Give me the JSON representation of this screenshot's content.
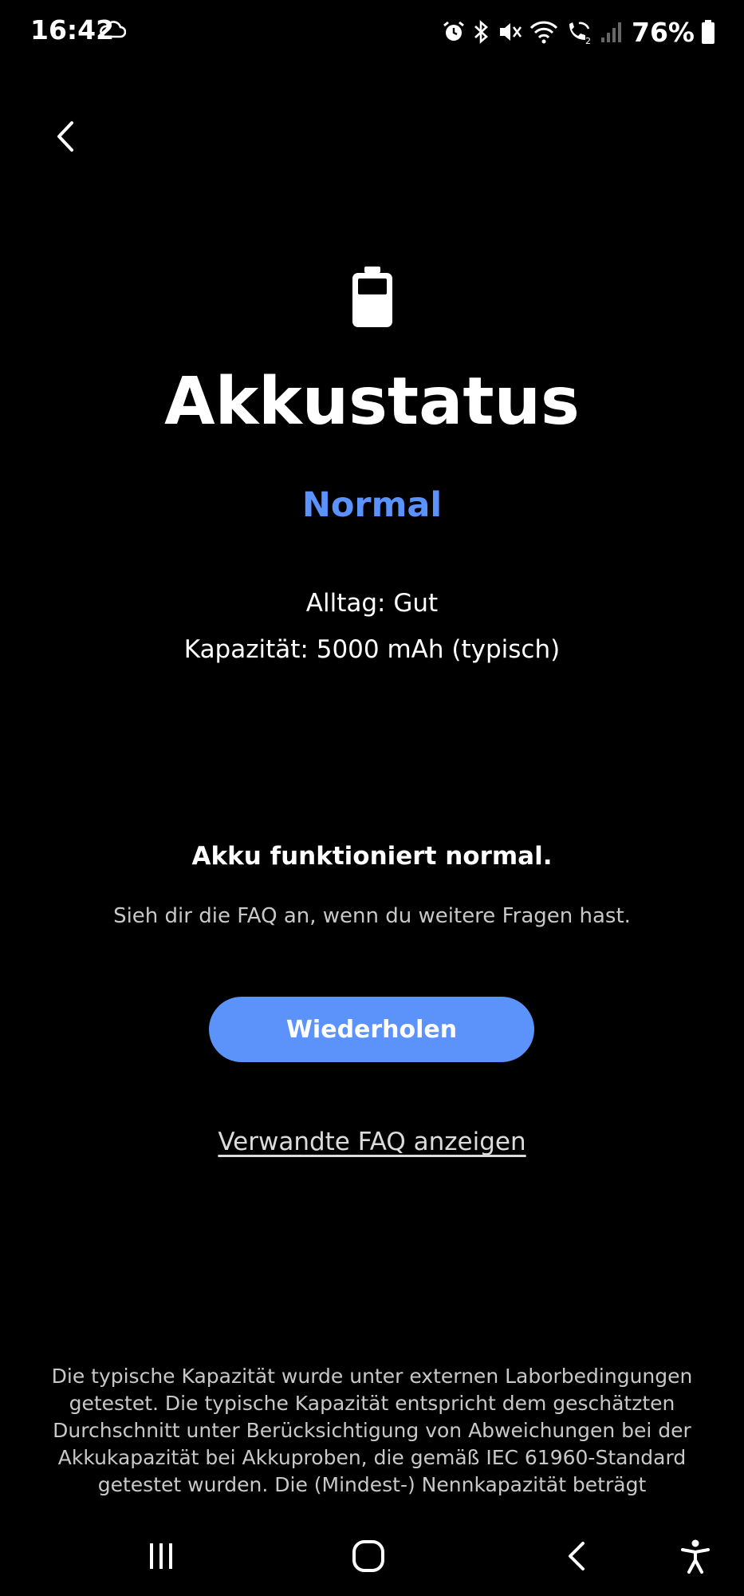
{
  "status_bar": {
    "time": "16:42",
    "battery_percent": "76%",
    "icons": [
      "cloud-icon",
      "alarm-icon",
      "bluetooth-icon",
      "mute-icon",
      "wifi-icon",
      "wifi-calling-icon",
      "signal-icon",
      "battery-icon"
    ]
  },
  "page": {
    "title": "Akkustatus",
    "status": "Normal",
    "status_color": "#5a92ff",
    "daily_use": "Alltag: Gut",
    "capacity": "Kapazität: 5000 mAh (typisch)",
    "message_title": "Akku funktioniert normal.",
    "message_hint": "Sieh dir die FAQ an, wenn du weitere Fragen hast.",
    "retry_button": "Wiederholen",
    "retry_button_color": "#5b93fb",
    "faq_link": "Verwandte FAQ anzeigen",
    "disclaimer": "Die typische Kapazität wurde unter externen Laborbedingungen getestet. Die typische Kapazität entspricht dem geschätzten Durchschnitt unter Berücksichtigung von Abweichungen bei der Akkukapazität bei Akkuproben, die gemäß IEC 61960-Standard getestet wurden. Die (Mindest-) Nennkapazität beträgt"
  },
  "nav_bar": {
    "icons": [
      "recents-icon",
      "home-icon",
      "back-icon",
      "accessibility-icon"
    ]
  }
}
